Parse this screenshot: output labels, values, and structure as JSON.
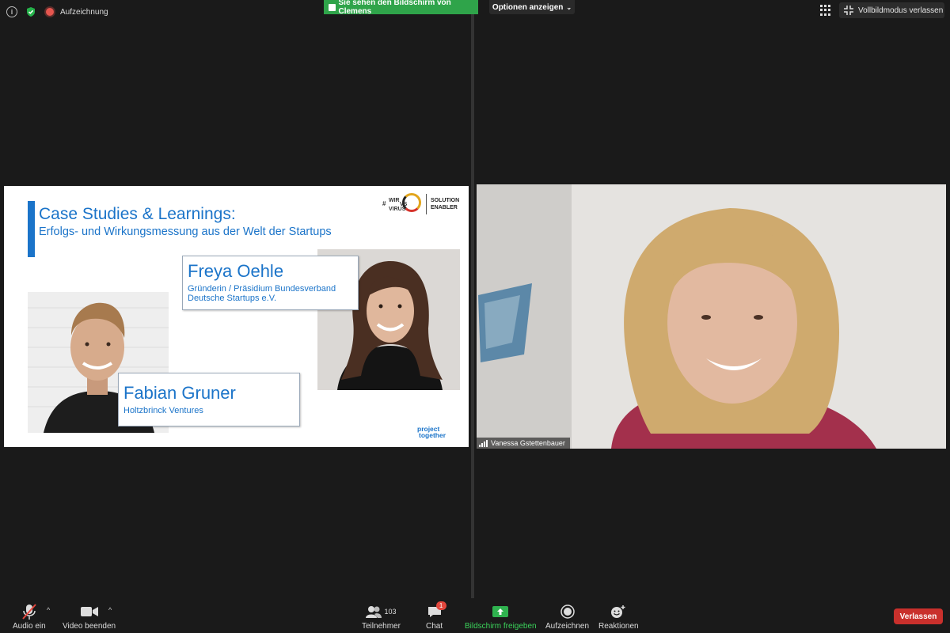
{
  "topbar": {
    "recording_label": "Aufzeichnung",
    "share_banner": "Sie sehen den Bildschirm von Clemens",
    "options_label": "Optionen anzeigen",
    "exit_fullscreen_label": "Vollbildmodus verlassen"
  },
  "slide": {
    "title": "Case Studies & Learnings:",
    "subtitle": "Erfolgs- und Wirkungsmessung aus der Welt der Startups",
    "logo_hash": "#",
    "logo_wir": "WIR",
    "logo_vs": "VS",
    "logo_virus": "VIRUS",
    "logo_solution": "SOLUTION",
    "logo_enabler": "ENABLER",
    "speaker1_name": "Freya Oehle",
    "speaker1_role_line1": "Gründerin / Präsidium Bundesverband",
    "speaker1_role_line2": "Deutsche Startups e.V.",
    "speaker2_name": "Fabian Gruner",
    "speaker2_role": "Holtzbrinck Ventures",
    "footer_logo_line1": "project",
    "footer_logo_line2": "together"
  },
  "video": {
    "participant_name": "Vanessa Gstettenbauer"
  },
  "toolbar": {
    "audio_label": "Audio ein",
    "video_label": "Video beenden",
    "participants_label": "Teilnehmer",
    "participants_count": "103",
    "chat_label": "Chat",
    "chat_badge": "1",
    "share_label": "Bildschirm freigeben",
    "record_label": "Aufzeichnen",
    "reactions_label": "Reaktionen",
    "leave_label": "Verlassen"
  },
  "colors": {
    "accent_blue": "#1b74c9",
    "share_green": "#2fa44a",
    "leave_red": "#c9302c"
  }
}
